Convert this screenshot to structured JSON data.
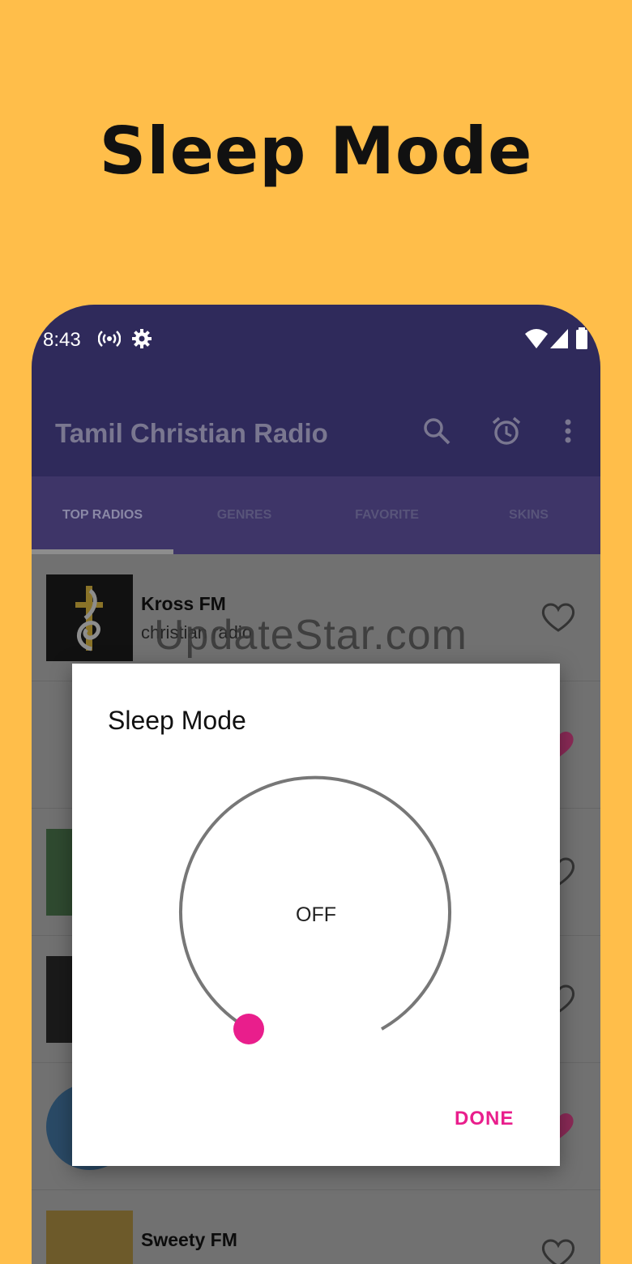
{
  "promo": {
    "title": "Sleep Mode"
  },
  "status_bar": {
    "time": "8:43",
    "left_icons": [
      "radio-broadcast-icon",
      "gear-icon"
    ],
    "right_icons": [
      "wifi-icon",
      "signal-icon",
      "battery-icon"
    ]
  },
  "app_bar": {
    "title": "Tamil Christian Radio",
    "actions": [
      "search-icon",
      "alarm-clock-icon",
      "more-vert-icon"
    ]
  },
  "tabs": [
    {
      "label": "TOP RADIOS",
      "active": true
    },
    {
      "label": "GENRES",
      "active": false
    },
    {
      "label": "FAVORITE",
      "active": false
    },
    {
      "label": "SKINS",
      "active": false
    }
  ],
  "stations": [
    {
      "name": "Kross FM",
      "genre": "christian radio",
      "favorite": false
    },
    {
      "name": "Sweety FM",
      "genre": "",
      "favorite": false
    }
  ],
  "watermark": "UpdateStar.com",
  "dialog": {
    "title": "Sleep Mode",
    "value": "OFF",
    "done_label": "DONE",
    "accent_color": "#E91E8C"
  },
  "colors": {
    "background": "#FFBE4A",
    "app_bar": "#2F2A5B",
    "accent": "#E91E8C"
  }
}
